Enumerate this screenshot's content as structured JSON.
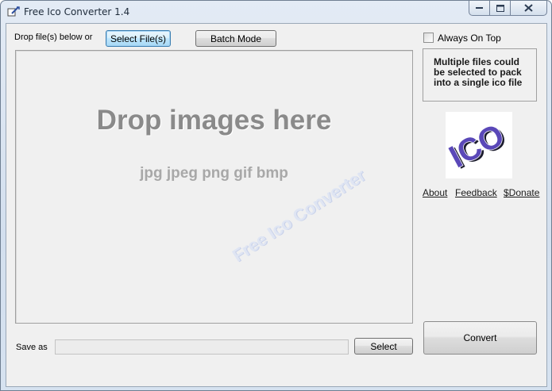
{
  "window": {
    "title": "Free Ico Converter 1.4",
    "controls": {
      "minimize_icon": "minimize-icon",
      "maximize_icon": "maximize-icon",
      "close_icon": "close-icon"
    }
  },
  "toolbar": {
    "drop_label": "Drop file(s) below or",
    "select_files_label": "Select File(s)",
    "batch_mode_label": "Batch Mode"
  },
  "dropzone": {
    "title": "Drop images here",
    "formats": "jpg jpeg png gif bmp",
    "watermark": "Free Ico Converter"
  },
  "sidebar": {
    "always_on_top_label": "Always On Top",
    "always_on_top_checked": false,
    "info_text": "Multiple files could be selected to pack into a single ico file",
    "logo_text": "ICO",
    "links": {
      "about": "About",
      "feedback": "Feedback",
      "donate": "$Donate"
    }
  },
  "footer": {
    "save_as_label": "Save as",
    "save_as_value": "",
    "select_label": "Select",
    "convert_label": "Convert"
  },
  "colors": {
    "window_bg": "#f0f0f0",
    "frame": "#d3dfee",
    "focus_border": "#3c7fb1",
    "logo_purple": "#5a48b8"
  }
}
